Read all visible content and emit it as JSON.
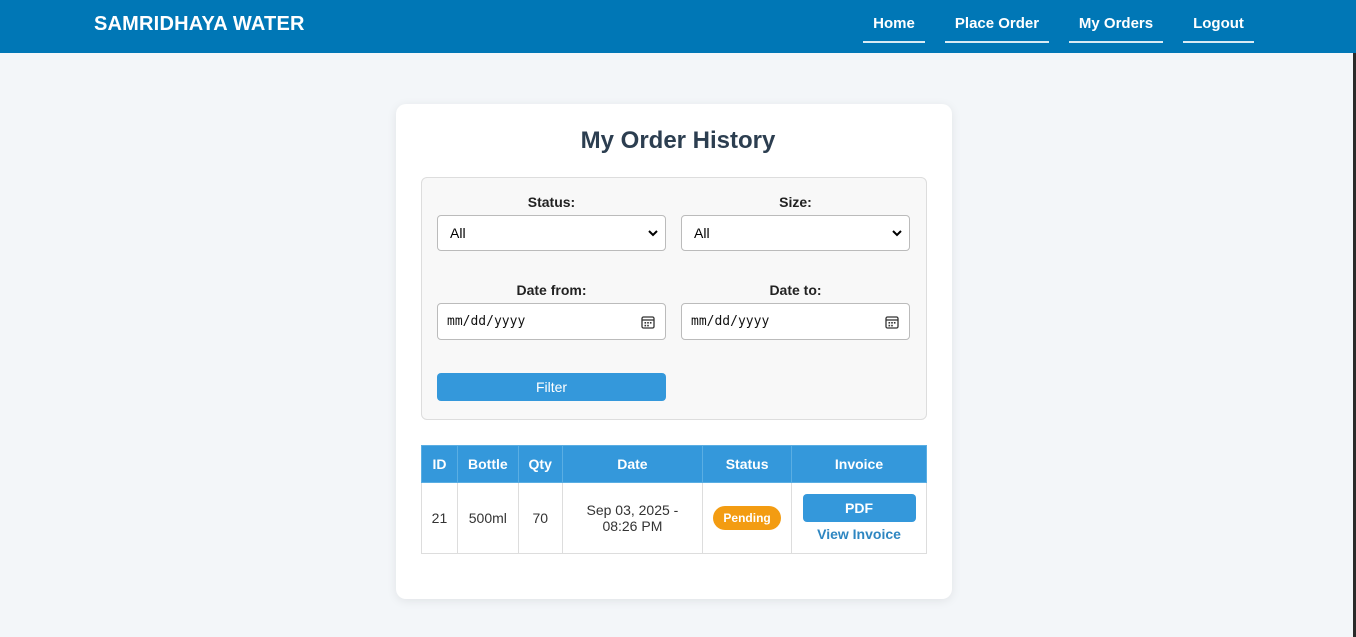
{
  "navbar": {
    "brand": "SAMRIDHAYA WATER",
    "links": [
      "Home",
      "Place Order",
      "My Orders",
      "Logout"
    ]
  },
  "page": {
    "title": "My Order History"
  },
  "filters": {
    "status_label": "Status:",
    "status_value": "All",
    "size_label": "Size:",
    "size_value": "All",
    "date_from_label": "Date from:",
    "date_from_placeholder": "mm/dd/yyyy",
    "date_to_label": "Date to:",
    "date_to_placeholder": "mm/dd/yyyy",
    "filter_button": "Filter"
  },
  "table": {
    "headers": [
      "ID",
      "Bottle",
      "Qty",
      "Date",
      "Status",
      "Invoice"
    ],
    "rows": [
      {
        "id": "21",
        "bottle": "500ml",
        "qty": "70",
        "date_line1": "Sep 03, 2025 -",
        "date_line2": "08:26 PM",
        "status": "Pending",
        "pdf_label": "PDF",
        "view_label": "View Invoice"
      }
    ]
  },
  "colors": {
    "navbar": "#0077b6",
    "accent": "#3498db",
    "pending": "#f39c12"
  }
}
